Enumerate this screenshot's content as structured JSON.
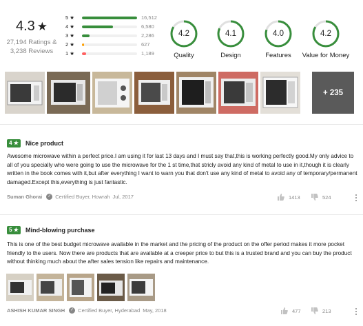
{
  "summary": {
    "rating": "4.3",
    "star_glyph": "★",
    "ratings_count": "27,194 Ratings &",
    "reviews_count": "3,238 Reviews"
  },
  "distribution": [
    {
      "label": "5 ★",
      "count": "16,512",
      "fraction": 1.0,
      "color": "#388e3c"
    },
    {
      "label": "4 ★",
      "count": "6,580",
      "fraction": 0.56,
      "color": "#388e3c"
    },
    {
      "label": "3 ★",
      "count": "2,286",
      "fraction": 0.14,
      "color": "#388e3c"
    },
    {
      "label": "2 ★",
      "count": "627",
      "fraction": 0.04,
      "color": "#ff9f00"
    },
    {
      "label": "1 ★",
      "count": "1,189",
      "fraction": 0.07,
      "color": "#ff6161"
    }
  ],
  "aspects": [
    {
      "value": "4.2",
      "caption": "Quality",
      "fraction": 0.84
    },
    {
      "value": "4.1",
      "caption": "Design",
      "fraction": 0.82
    },
    {
      "value": "4.0",
      "caption": "Features",
      "fraction": 0.8
    },
    {
      "value": "4.2",
      "caption": "Value for Money",
      "fraction": 0.84
    }
  ],
  "gallery": {
    "more_label": "+ 235"
  },
  "reviews": [
    {
      "rating": "4 ★",
      "title": "Nice product",
      "body": "Awesome microwave within a perfect price.I am using it for last 13 days and I must say that,this is working perfectly good.My only advice to all of you specially who were going to use the microwave for the 1 st time,that stricly avoid any kind of metal to use in it,though it is clearly written in the book comes with it,but after everything I want to warn you that don't use any kind of metal to avoid any of temporary/permanent damaged.Except this,everything is just fantastic.",
      "author": "Suman Ghorai",
      "certified": "Certified Buyer, Howrah",
      "date": "Jul, 2017",
      "likes": "1413",
      "dislikes": "524"
    },
    {
      "rating": "5 ★",
      "title": "Mind-blowing purchase",
      "body": "This is one of the best budget microwave available in the market and the pricing of the product on the offer period makes it more pocket friendly to the users. Now there are products that are available at a creeper price to but this is a trusted brand and you can buy the product without thinking much about the after sales tension like repairs and maintenance.",
      "author": "ASHISH KUMAR SINGH",
      "certified": "Certified Buyer, Hyderabad",
      "date": "May, 2018",
      "likes": "477",
      "dislikes": "213"
    }
  ],
  "colors": {
    "accent_green": "#388e3c",
    "muted": "#878787"
  }
}
